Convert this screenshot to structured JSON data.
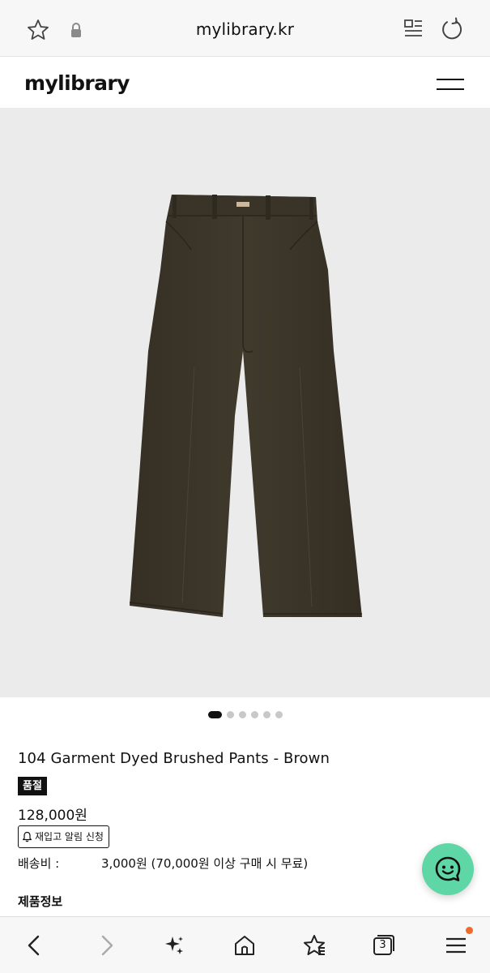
{
  "browser": {
    "domain": "mylibrary.kr",
    "icons": [
      "star-icon",
      "lock-icon",
      "reader-mode-icon",
      "reload-icon"
    ]
  },
  "site": {
    "logo": "mylibrary",
    "menu_icon": "hamburger-menu-icon"
  },
  "gallery": {
    "image": "brown wide-leg pants on light gray background",
    "slide_count": 6,
    "active_slide": 1
  },
  "product": {
    "name": "104 Garment Dyed Brushed Pants - Brown",
    "badge": "품절",
    "price": "128,000원",
    "restock_button": "재입고 알림 신청",
    "shipping_label": "배송비 :",
    "shipping_value": "3,000원 (70,000원 이상 구매 시 무료)",
    "info_heading": "제품정보"
  },
  "toolbar": {
    "tabs_count": "3",
    "items": [
      "back-icon",
      "forward-icon",
      "sparkle-icon",
      "home-icon",
      "bookmark-star-icon",
      "tabs-icon",
      "menu-icon"
    ]
  },
  "colors": {
    "chat_button": "#5ed6a6",
    "notification_dot": "#f06a2a",
    "gallery_bg": "#ebebeb",
    "pants": "#3b3528"
  }
}
